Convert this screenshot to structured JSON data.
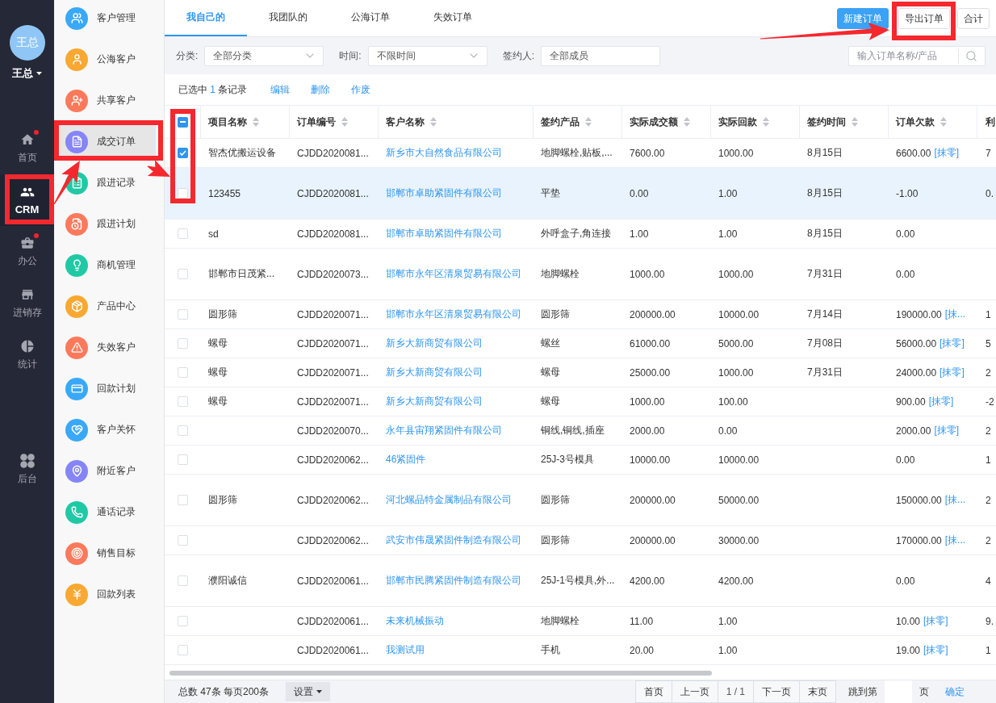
{
  "user": {
    "avatar": "王总",
    "name": "王总"
  },
  "nav": [
    {
      "label": "首页",
      "selected": false,
      "dot": true
    },
    {
      "label": "CRM",
      "selected": true,
      "dot": false
    },
    {
      "label": "办公",
      "selected": false,
      "dot": true
    },
    {
      "label": "进销存",
      "selected": false,
      "dot": false
    },
    {
      "label": "统计",
      "selected": false,
      "dot": false
    }
  ],
  "nav_footer": [
    {
      "label": "后台",
      "selected": false,
      "dot": false
    }
  ],
  "submenu": [
    {
      "label": "客户管理",
      "selected": false,
      "color": "#3aa8f8"
    },
    {
      "label": "公海客户",
      "selected": false,
      "color": "#f9a832"
    },
    {
      "label": "共享客户",
      "selected": false,
      "color": "#fc7a5b"
    },
    {
      "label": "成交订单",
      "selected": true,
      "color": "#8585f8"
    },
    {
      "label": "跟进记录",
      "selected": false,
      "color": "#20c9a5"
    },
    {
      "label": "跟进计划",
      "selected": false,
      "color": "#fc7a5b"
    },
    {
      "label": "商机管理",
      "selected": false,
      "color": "#20c9a5"
    },
    {
      "label": "产品中心",
      "selected": false,
      "color": "#f9a832"
    },
    {
      "label": "失效客户",
      "selected": false,
      "color": "#fc7a5b"
    },
    {
      "label": "回款计划",
      "selected": false,
      "color": "#3aa8f8"
    },
    {
      "label": "客户关怀",
      "selected": false,
      "color": "#3aa8f8"
    },
    {
      "label": "附近客户",
      "selected": false,
      "color": "#8585f8"
    },
    {
      "label": "通话记录",
      "selected": false,
      "color": "#20c9a5"
    },
    {
      "label": "销售目标",
      "selected": false,
      "color": "#fc7a5b"
    },
    {
      "label": "回款列表",
      "selected": false,
      "color": "#f9a832"
    }
  ],
  "tabs": [
    {
      "label": "我自己的",
      "selected": true
    },
    {
      "label": "我团队的",
      "selected": false
    },
    {
      "label": "公海订单",
      "selected": false
    },
    {
      "label": "失效订单",
      "selected": false
    }
  ],
  "buttons": [
    {
      "label": "新建订单",
      "kind": "primary"
    },
    {
      "label": "导出订单",
      "kind": "default"
    },
    {
      "label": "合计",
      "kind": "default"
    }
  ],
  "filters": [
    {
      "label": "分类:",
      "value": "全部分类",
      "kind": "select"
    },
    {
      "label": "时间:",
      "value": "不限时间",
      "kind": "select"
    },
    {
      "label": "签约人:",
      "value": "全部成员",
      "kind": "input"
    }
  ],
  "search": {
    "placeholder": "输入订单名称/产品"
  },
  "selection": {
    "before": "已选中",
    "count": "1",
    "after": "条记录"
  },
  "actions": [
    "编辑",
    "删除",
    "作废"
  ],
  "table": {
    "select_all": {
      "indeterminate": true
    },
    "columns": [
      {
        "label": "项目名称",
        "sortable": true,
        "kind": "text"
      },
      {
        "label": "订单编号",
        "sortable": true,
        "kind": "text"
      },
      {
        "label": "客户名称",
        "sortable": true,
        "kind": "link"
      },
      {
        "label": "签约产品",
        "sortable": true,
        "kind": "text"
      },
      {
        "label": "实际成交额",
        "sortable": true,
        "kind": "text"
      },
      {
        "label": "实际回款",
        "sortable": true,
        "kind": "text"
      },
      {
        "label": "签约时间",
        "sortable": true,
        "kind": "text"
      },
      {
        "label": "订单欠款",
        "sortable": true,
        "kind": "amount_action"
      },
      {
        "label": "利",
        "sortable": false,
        "kind": "text"
      }
    ],
    "rows": [
      {
        "checked": true,
        "hovered": false,
        "project": "智杰优搬运设备",
        "order_no": "CJDD2020081...",
        "customer": "新乡市大自然食品有限公司",
        "product": "地脚螺栓,贴板,...",
        "deal_amount": "7600.00",
        "received": "1000.00",
        "sign_date": "8月15日",
        "debt": {
          "amount": "6600.00",
          "action": "[抹零]"
        },
        "column_10": "7"
      },
      {
        "checked": false,
        "hovered": true,
        "project": "123455",
        "order_no": "CJDD2020081...",
        "customer": "邯郸市卓助紧固件有限公司",
        "product": "平垫",
        "deal_amount": "0.00",
        "received": "1.00",
        "sign_date": "8月15日",
        "debt": {
          "amount": "-1.00"
        },
        "column_10": "0."
      },
      {
        "checked": false,
        "hovered": false,
        "project": "sd",
        "order_no": "CJDD2020081...",
        "customer": "邯郸市卓助紧固件有限公司",
        "product": "外呼盒子,角连接",
        "deal_amount": "1.00",
        "received": "1.00",
        "sign_date": "8月15日",
        "debt": {
          "amount": "0.00"
        }
      },
      {
        "checked": false,
        "hovered": false,
        "project": "邯郸市日茂紧...",
        "order_no": "CJDD2020073...",
        "customer": "邯郸市永年区清泉贸易有限公司",
        "product": "地脚螺栓",
        "deal_amount": "1000.00",
        "received": "1000.00",
        "sign_date": "7月31日",
        "debt": {
          "amount": "0.00"
        }
      },
      {
        "checked": false,
        "hovered": false,
        "project": "圆形筛",
        "order_no": "CJDD2020071...",
        "customer": "邯郸市永年区清泉贸易有限公司",
        "product": "圆形筛",
        "deal_amount": "200000.00",
        "received": "10000.00",
        "sign_date": "7月14日",
        "debt": {
          "amount": "190000.00",
          "action": "[抹..."
        },
        "column_10": "1"
      },
      {
        "checked": false,
        "hovered": false,
        "project": "螺母",
        "order_no": "CJDD2020071...",
        "customer": "新乡大新商贸有限公司",
        "product": "螺丝",
        "deal_amount": "61000.00",
        "received": "5000.00",
        "sign_date": "7月08日",
        "debt": {
          "amount": "56000.00",
          "action": "[抹零]"
        },
        "column_10": "5"
      },
      {
        "checked": false,
        "hovered": false,
        "project": "螺母",
        "order_no": "CJDD2020071...",
        "customer": "新乡大新商贸有限公司",
        "product": "螺母",
        "deal_amount": "25000.00",
        "received": "1000.00",
        "sign_date": "7月31日",
        "debt": {
          "amount": "24000.00",
          "action": "[抹零]"
        },
        "column_10": "2"
      },
      {
        "checked": false,
        "hovered": false,
        "project": "螺母",
        "order_no": "CJDD2020071...",
        "customer": "新乡大新商贸有限公司",
        "product": "螺母",
        "deal_amount": "1000.00",
        "received": "100.00",
        "debt": {
          "amount": "900.00",
          "action": "[抹零]"
        },
        "column_10": "-2"
      },
      {
        "checked": false,
        "hovered": false,
        "order_no": "CJDD2020070...",
        "customer": "永年县宙翔紧固件有限公司",
        "product": "铜线,铜线,插座",
        "deal_amount": "2000.00",
        "received": "0.00",
        "debt": {
          "amount": "2000.00",
          "action": "[抹零]"
        },
        "column_10": "2"
      },
      {
        "checked": false,
        "hovered": false,
        "order_no": "CJDD2020062...",
        "customer": "46紧固件",
        "product": "25J-3号模具",
        "deal_amount": "10000.00",
        "received": "10000.00",
        "debt": {
          "amount": "0.00"
        },
        "column_10": "1"
      },
      {
        "checked": false,
        "hovered": false,
        "project": "圆形筛",
        "order_no": "CJDD2020062...",
        "customer": "河北螺品特金属制品有限公司",
        "product": "圆形筛",
        "deal_amount": "200000.00",
        "received": "50000.00",
        "debt": {
          "amount": "150000.00",
          "action": "[抹..."
        },
        "column_10": "2"
      },
      {
        "checked": false,
        "hovered": false,
        "order_no": "CJDD2020062...",
        "customer": "武安市伟晟紧固件制造有限公司",
        "product": "圆形筛",
        "deal_amount": "200000.00",
        "received": "30000.00",
        "debt": {
          "amount": "170000.00",
          "action": "[抹..."
        },
        "column_10": "2"
      },
      {
        "checked": false,
        "hovered": false,
        "project": "濮阳诚信",
        "order_no": "CJDD2020061...",
        "customer": "邯郸市民腾紧固件制造有限公司",
        "product": "25J-1号模具,外...",
        "deal_amount": "4200.00",
        "received": "4200.00",
        "debt": {
          "amount": "0.00"
        },
        "column_10": "4"
      },
      {
        "checked": false,
        "hovered": false,
        "order_no": "CJDD2020061...",
        "customer": "未来机械振动",
        "product": "地脚螺栓",
        "deal_amount": "11.00",
        "received": "1.00",
        "debt": {
          "amount": "10.00",
          "action": "[抹零]"
        },
        "column_10": "9."
      },
      {
        "checked": false,
        "hovered": false,
        "order_no": "CJDD2020061...",
        "customer": "我测试用",
        "product": "手机",
        "deal_amount": "20.00",
        "received": "1.00",
        "debt": {
          "amount": "19.00",
          "action": "[抹零]"
        },
        "column_10": "1"
      }
    ]
  },
  "footer": {
    "summary": "总数 47条 每页200条",
    "settings": "设置",
    "pager": [
      {
        "label": "首页",
        "kind": "button"
      },
      {
        "label": "上一页",
        "kind": "button"
      },
      {
        "label": "1 / 1",
        "kind": "indicator"
      },
      {
        "label": "下一页",
        "kind": "button"
      },
      {
        "label": "末页",
        "kind": "button"
      }
    ],
    "jump_label": "跳到第",
    "jump_unit": "页",
    "confirm": "确定"
  }
}
